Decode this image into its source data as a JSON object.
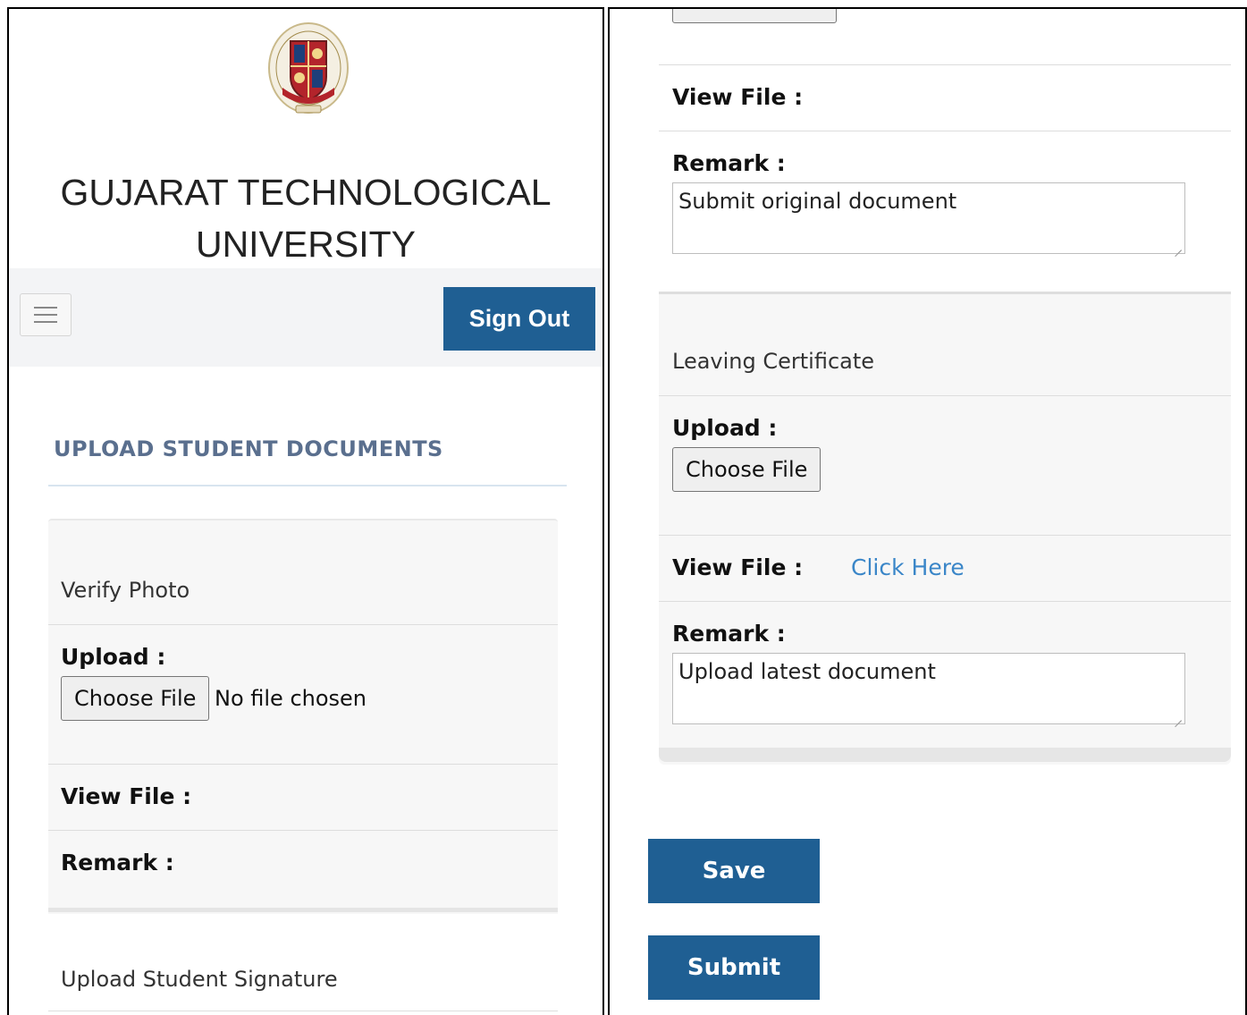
{
  "header": {
    "university_name": "GUJARAT TECHNOLOGICAL UNIVERSITY",
    "sign_out_label": "Sign Out"
  },
  "page": {
    "section_title": "UPLOAD STUDENT DOCUMENTS"
  },
  "labels": {
    "upload": "Upload :",
    "view_file": "View File :",
    "remark": "Remark :",
    "choose_file": "Choose File",
    "no_file_chosen": "No file chosen",
    "click_here": "Click Here"
  },
  "documents": [
    {
      "title": "Verify Photo",
      "file_status": "No file chosen",
      "view_link": "",
      "remark": ""
    },
    {
      "title": "Upload Student Signature"
    },
    {
      "title": "",
      "view_link": "",
      "remark": "Submit original document"
    },
    {
      "title": "Leaving Certificate",
      "view_link": "Click Here",
      "remark": "Upload latest document"
    }
  ],
  "actions": {
    "save_label": "Save",
    "submit_label": "Submit"
  },
  "colors": {
    "primary_button": "#1f5f93",
    "link": "#3a86c8",
    "section_title": "#5a6f8e",
    "card_background": "#f7f7f7",
    "navbar_background": "#f3f4f6"
  },
  "icons": {
    "menu": "hamburger-icon",
    "logo": "university-seal-logo"
  }
}
